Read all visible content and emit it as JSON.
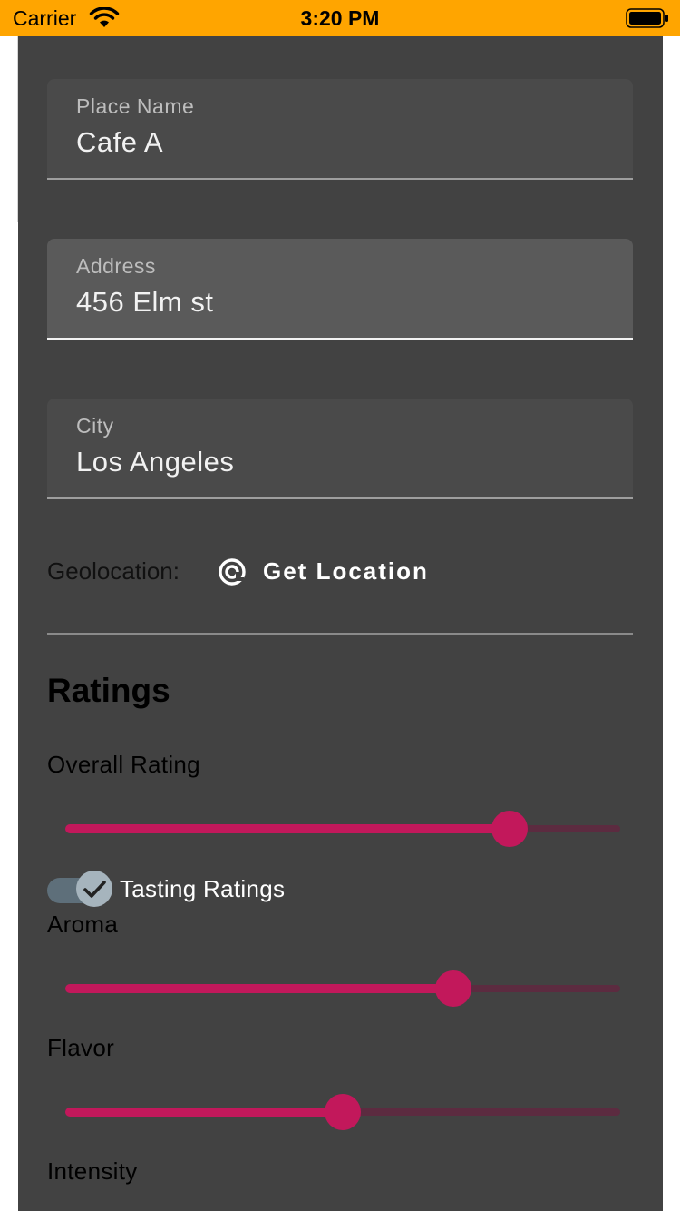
{
  "status_bar": {
    "carrier": "Carrier",
    "time": "3:20 PM",
    "color": "#ffa500"
  },
  "form": {
    "place_name": {
      "label": "Place Name",
      "value": "Cafe A"
    },
    "address": {
      "label": "Address",
      "value": "456 Elm st"
    },
    "city": {
      "label": "City",
      "value": "Los Angeles"
    }
  },
  "geolocation": {
    "label": "Geolocation:",
    "button_label": "Get Location",
    "icon": "target-icon"
  },
  "ratings": {
    "title": "Ratings",
    "overall": {
      "label": "Overall Rating",
      "value": 0.8
    },
    "tasting_toggle": {
      "label": "Tasting Ratings",
      "checked": true
    },
    "aroma": {
      "label": "Aroma",
      "value": 0.7
    },
    "flavor": {
      "label": "Flavor",
      "value": 0.5
    },
    "intensity": {
      "label": "Intensity"
    }
  },
  "colors": {
    "accent": "#c2185b",
    "background": "#424242"
  }
}
